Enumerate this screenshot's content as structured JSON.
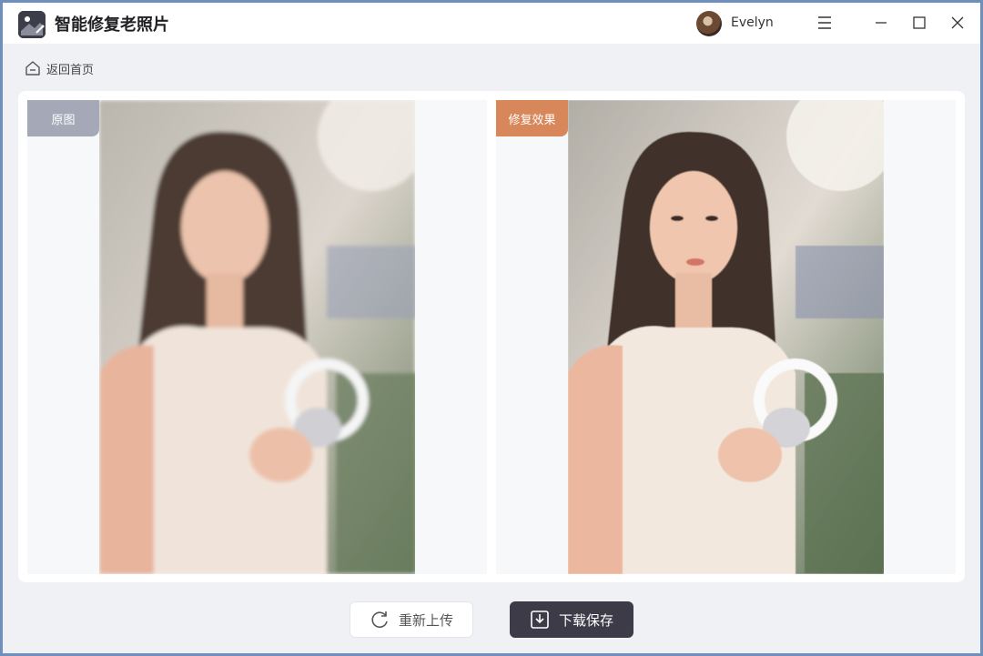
{
  "app": {
    "title": "智能修复老照片",
    "user": {
      "name": "Evelyn"
    }
  },
  "nav": {
    "back_label": "返回首页"
  },
  "panels": {
    "original_label": "原图",
    "result_label": "修复效果"
  },
  "actions": {
    "reupload_label": "重新上传",
    "save_label": "下载保存"
  },
  "colors": {
    "result_badge": "#d8875b",
    "original_badge": "#a5a9b7",
    "save_button": "#3d3b48",
    "window_border": "#6f8fbd"
  }
}
